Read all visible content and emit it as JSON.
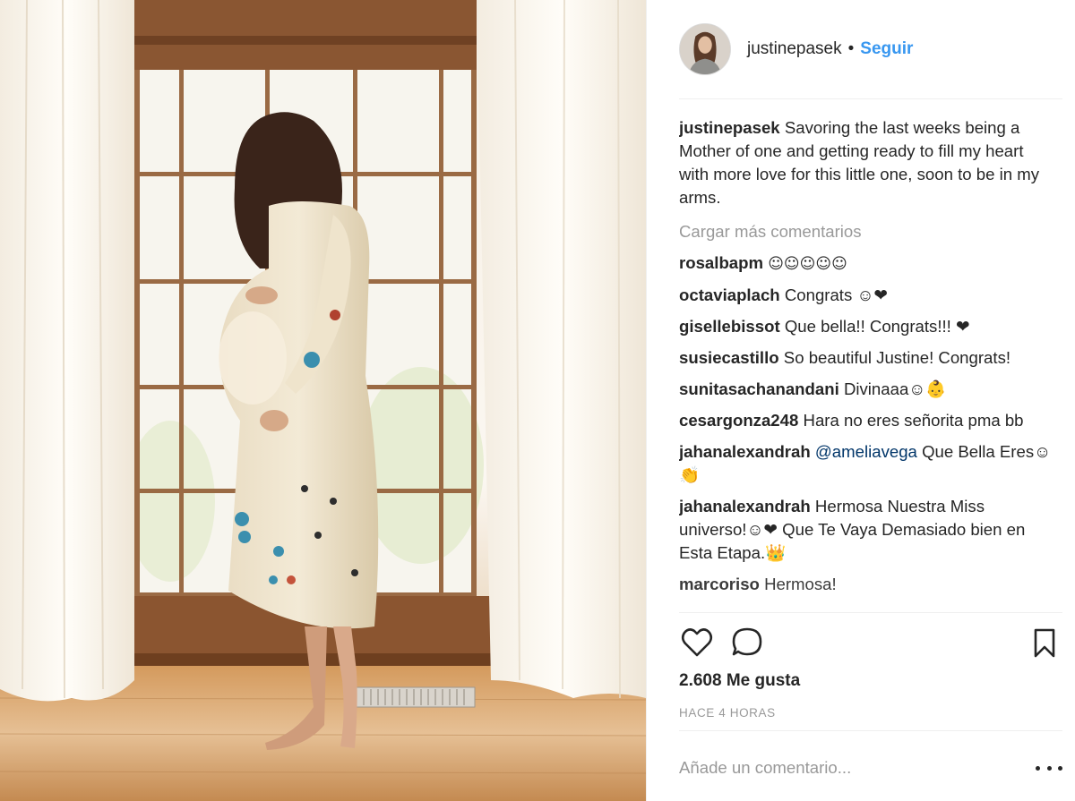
{
  "post": {
    "username": "justinepasek",
    "dot": "•",
    "follow_label": "Seguir",
    "caption": "Savoring the last weeks being a Mother of one and getting ready to fill my heart with more love for this little one, soon to be in my arms.",
    "load_more": "Cargar más comentarios",
    "likes": "2.608 Me gusta",
    "time_ago": "HACE 4 HORAS",
    "add_comment_placeholder": "Añade un comentario..."
  },
  "comments": [
    {
      "user": "rosalbapm",
      "text": "☺☺☺☺☺"
    },
    {
      "user": "octaviaplach",
      "text": "Congrats ☺❤"
    },
    {
      "user": "gisellebissot",
      "text": "Que bella!! Congrats!!! ❤"
    },
    {
      "user": "susiecastillo",
      "text": "So beautiful Justine! Congrats!"
    },
    {
      "user": "sunitasachanandani",
      "text": "Divinaaa☺👶"
    },
    {
      "user": "cesargonza248",
      "text": "Hara no eres señorita pma bb"
    },
    {
      "user": "jahanalexandrah",
      "mention": "@ameliavega",
      "text": "Que Bella Eres☺👏"
    },
    {
      "user": "jahanalexandrah",
      "text": "Hermosa Nuestra Miss universo!☺❤ Que Te Vaya Demasiado bien en Esta Etapa.👑"
    },
    {
      "user": "marcoriso",
      "text": "Hermosa!"
    }
  ],
  "icons": {
    "like": "heart-outline-icon",
    "comment": "speech-bubble-icon",
    "save": "bookmark-icon",
    "more": "ellipsis-icon"
  },
  "colors": {
    "link_blue": "#3897f0",
    "text": "#262626",
    "muted": "#999999",
    "divider": "#efefef"
  }
}
